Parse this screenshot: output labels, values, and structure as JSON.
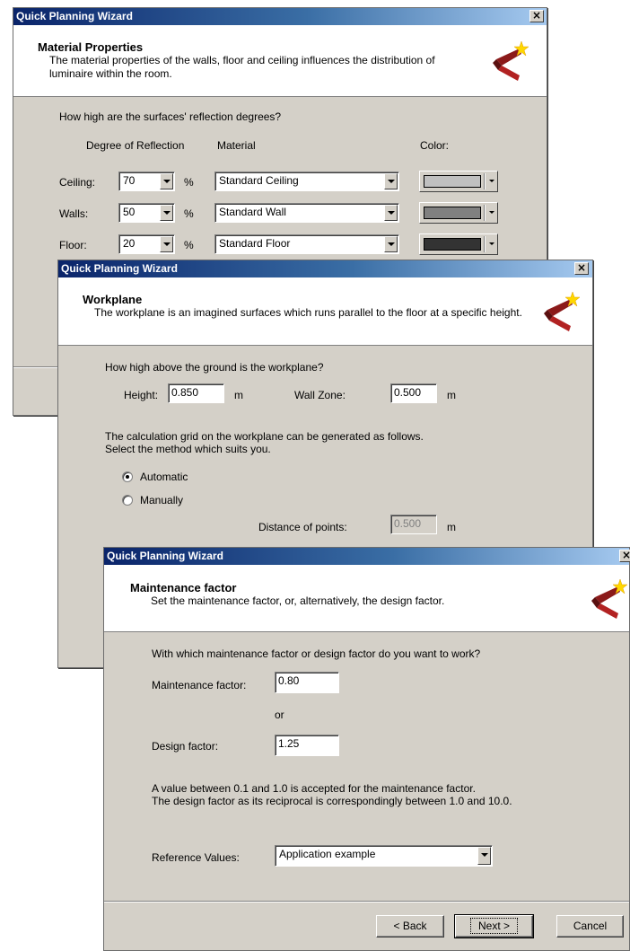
{
  "dialog1": {
    "title": "Quick Planning Wizard",
    "close_label": "×",
    "header": {
      "title": "Material Properties",
      "description": "The material properties of the walls, floor and ceiling influences the distribution of luminaire within the room."
    },
    "question": "How high are the surfaces' reflection degrees?",
    "col_reflection": "Degree of Reflection",
    "col_material": "Material",
    "col_color": "Color:",
    "percent": "%",
    "rows": [
      {
        "label": "Ceiling:",
        "value": "70",
        "material": "Standard Ceiling",
        "color": "#c0c0c0"
      },
      {
        "label": "Walls:",
        "value": "50",
        "material": "Standard Wall",
        "color": "#808080"
      },
      {
        "label": "Floor:",
        "value": "20",
        "material": "Standard Floor",
        "color": "#333333"
      }
    ]
  },
  "dialog2": {
    "title": "Quick Planning Wizard",
    "close_label": "×",
    "header": {
      "title": "Workplane",
      "description": "The workplane is an imagined surfaces which runs parallel to the floor at a specific height."
    },
    "question": "How high above the ground is the workplane?",
    "height_label": "Height:",
    "height_value": "0.850",
    "height_unit": "m",
    "wallzone_label": "Wall Zone:",
    "wallzone_value": "0.500",
    "wallzone_unit": "m",
    "grid_text_line1": "The calculation grid on the workplane can be generated as follows.",
    "grid_text_line2": "Select the method which suits you.",
    "radio_automatic": "Automatic",
    "radio_manually": "Manually",
    "selected_method": "Automatic",
    "distance_label": "Distance of points:",
    "distance_value": "0.500",
    "distance_unit": "m"
  },
  "dialog3": {
    "title": "Quick Planning Wizard",
    "close_label": "×",
    "header": {
      "title": "Maintenance factor",
      "description": "Set the maintenance factor, or, alternatively, the design factor."
    },
    "question": "With which maintenance factor or design factor do you want to work?",
    "maintenance_label": "Maintenance factor:",
    "maintenance_value": "0.80",
    "or_label": "or",
    "design_label": "Design factor:",
    "design_value": "1.25",
    "info_line1": "A value between 0.1 and 1.0 is accepted for the maintenance factor.",
    "info_line2": "The design factor as its reciprocal is correspondingly between 1.0 and 10.0.",
    "reference_label": "Reference Values:",
    "reference_value": "Application example",
    "back_label": "< Back",
    "next_label": "Next >",
    "cancel_label": "Cancel"
  }
}
